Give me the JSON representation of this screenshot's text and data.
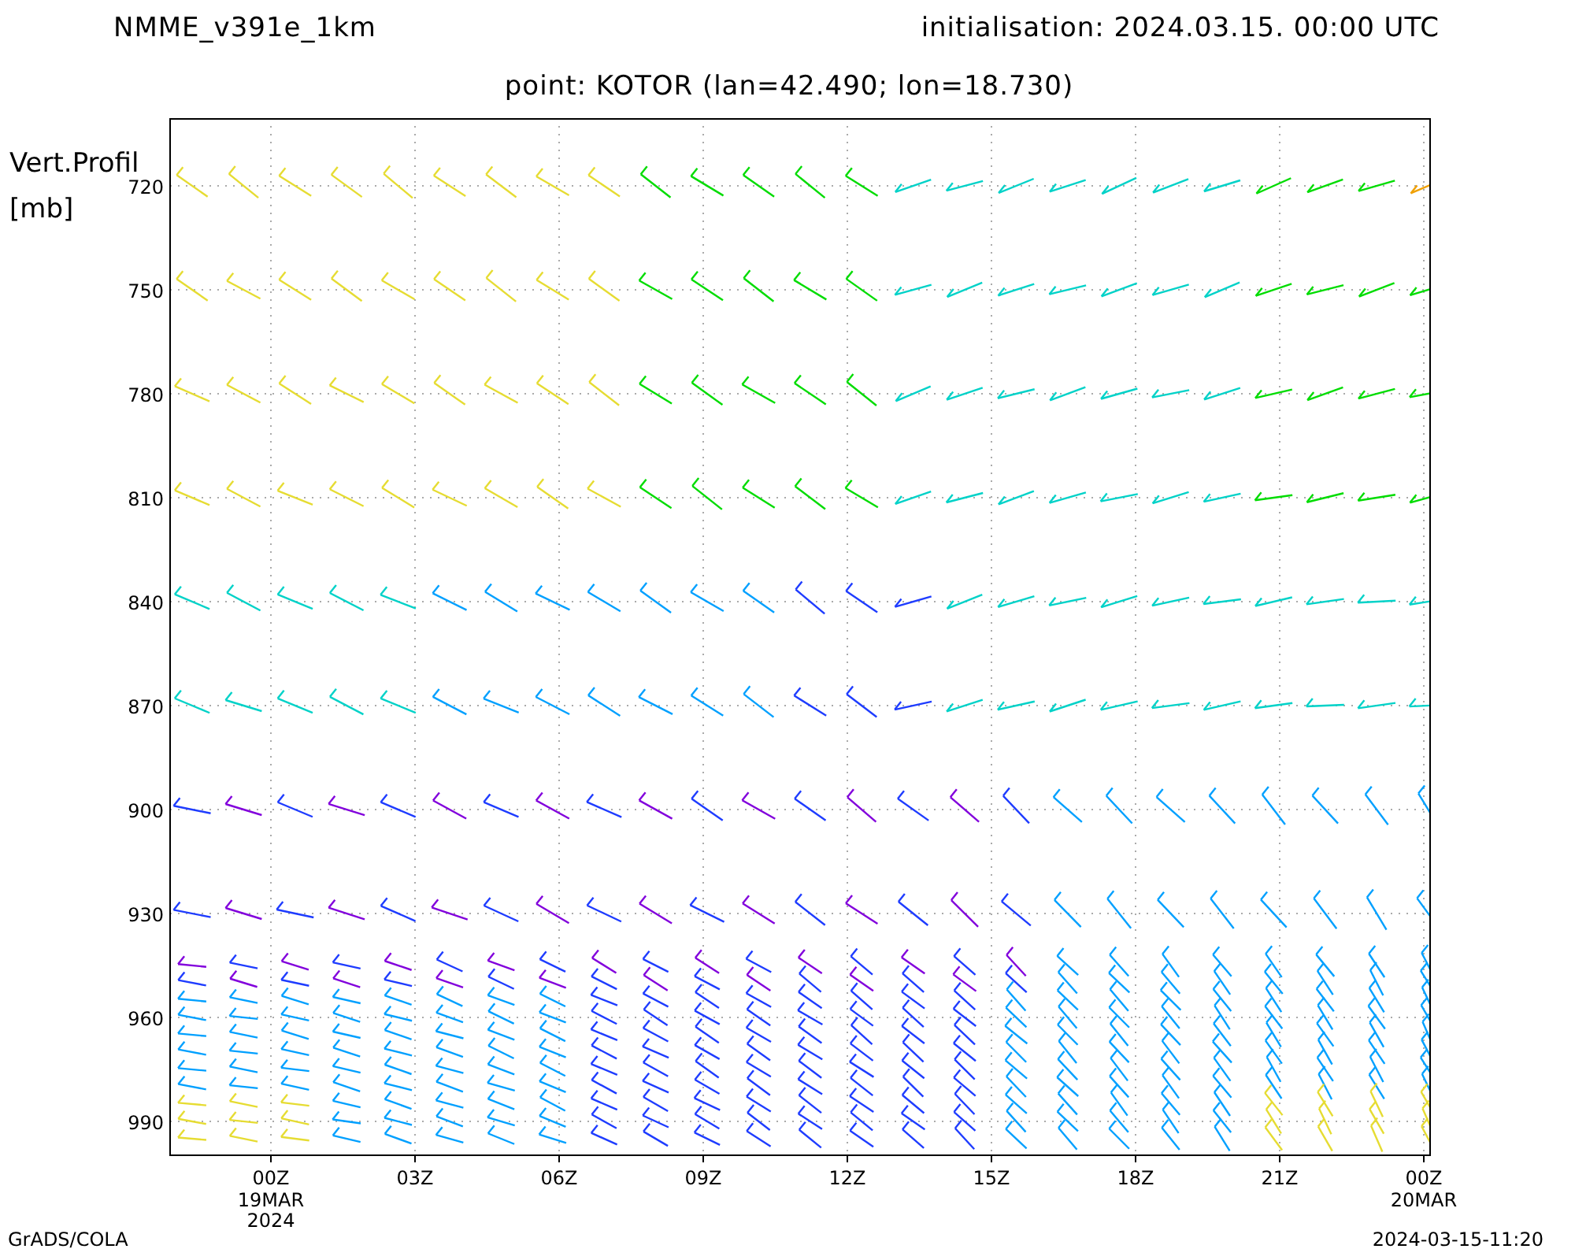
{
  "header": {
    "model": "NMME_v391e_1km",
    "initialisation": "initialisation: 2024.03.15. 00:00 UTC",
    "point": "point: KOTOR (lan=42.490; lon=18.730)"
  },
  "y_axis": {
    "title": "Vert.Profil",
    "unit": "[mb]",
    "ticks": [
      "720",
      "750",
      "780",
      "810",
      "840",
      "870",
      "900",
      "930",
      "960",
      "990"
    ]
  },
  "x_axis": {
    "ticks": [
      {
        "label": "00Z",
        "date": "19MAR",
        "year": "2024"
      },
      {
        "label": "03Z"
      },
      {
        "label": "06Z"
      },
      {
        "label": "09Z"
      },
      {
        "label": "12Z"
      },
      {
        "label": "15Z"
      },
      {
        "label": "18Z"
      },
      {
        "label": "21Z"
      },
      {
        "label": "00Z",
        "date": "20MAR"
      }
    ]
  },
  "footer": {
    "left": "GrADS/COLA",
    "right": "2024-03-15-11:20"
  }
}
